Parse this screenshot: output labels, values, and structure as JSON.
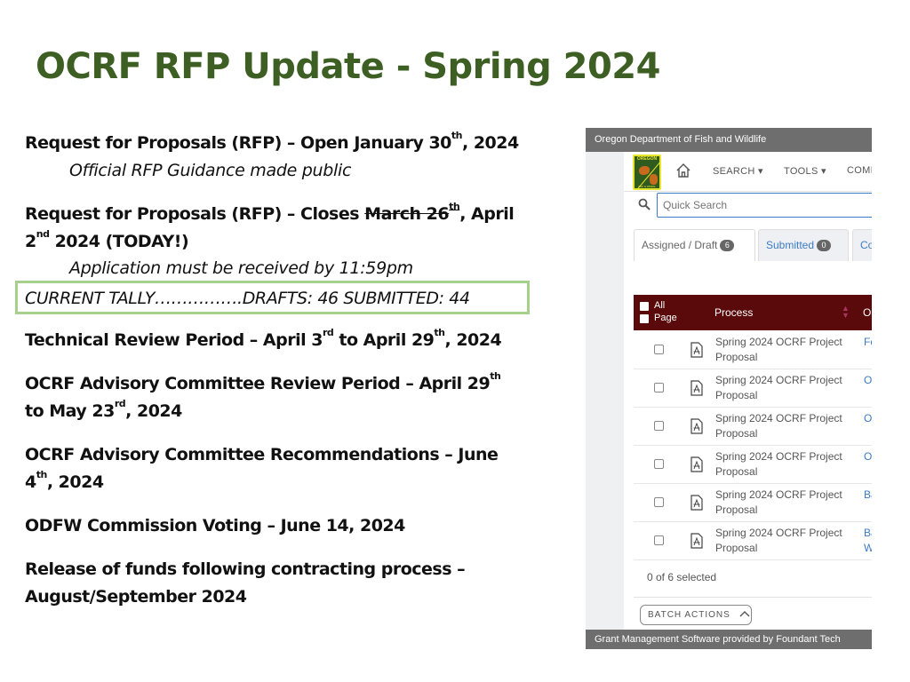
{
  "slide": {
    "title": "OCRF RFP Update - Spring 2024"
  },
  "timeline": {
    "open": {
      "text_a": "Request for Proposals (RFP) – Open January 30",
      "sup": "th",
      "text_b": ", 2024",
      "sub": "Official RFP Guidance made public"
    },
    "closes": {
      "text_a": "Request for Proposals (RFP) – Closes ",
      "struck": "March 26",
      "struck_sup": "th",
      "text_b": ", April",
      "line2_a": "2",
      "line2_sup": "nd",
      "line2_b": " 2024 (TODAY!)",
      "sub": "Application must be received by 11:59pm"
    },
    "tally": {
      "text": "CURRENT TALLY…………….DRAFTS: 46   SUBMITTED: 44",
      "drafts": 46,
      "submitted": 44
    },
    "technical": {
      "text_a": "Technical Review Period – April 3",
      "sup1": "rd",
      "text_b": " to April 29",
      "sup2": "th",
      "text_c": ", 2024"
    },
    "advisory_review": {
      "text_a": "OCRF Advisory Committee Review Period – April 29",
      "sup1": "th",
      "line2_a": "to May 23",
      "sup2": "rd",
      "line2_b": ", 2024"
    },
    "advisory_rec": {
      "text_a": "OCRF Advisory Committee Recommendations – June",
      "line2_a": "4",
      "sup": "th",
      "line2_b": ", 2024"
    },
    "commission": {
      "text": "ODFW Commission Voting – June 14, 2024"
    },
    "release": {
      "line1": "Release of funds following contracting process –",
      "line2": "August/September 2024"
    }
  },
  "screenshot": {
    "org_bar": "Oregon Department of Fish and Wildlife",
    "logo_top": "OREGON",
    "logo_bottom": "Fish & Wildlife",
    "nav": {
      "search": "SEARCH ▾",
      "tools": "TOOLS ▾",
      "more": "COMI"
    },
    "quick_search_placeholder": "Quick Search",
    "tabs": [
      {
        "label": "Assigned / Draft",
        "count": "6",
        "active": true
      },
      {
        "label": "Submitted",
        "count": "0",
        "active": false
      },
      {
        "label": "Co",
        "count": "",
        "active": false
      }
    ],
    "grid": {
      "select_all": "All",
      "select_page": "Page",
      "process_header": "Process",
      "next_header": "O",
      "rows": [
        {
          "line1": "Spring 2024 OCRF Project",
          "line2": "Proposal",
          "link1": "Fo",
          "link2": ""
        },
        {
          "line1": "Spring 2024 OCRF Project",
          "line2": "Proposal",
          "link1": "O",
          "link2": ""
        },
        {
          "line1": "Spring 2024 OCRF Project",
          "line2": "Proposal",
          "link1": "O",
          "link2": ""
        },
        {
          "line1": "Spring 2024 OCRF Project",
          "line2": "Proposal",
          "link1": "O",
          "link2": ""
        },
        {
          "line1": "Spring 2024 OCRF Project",
          "line2": "Proposal",
          "link1": "Ba",
          "link2": ""
        },
        {
          "line1": "Spring 2024 OCRF Project",
          "line2": "Proposal",
          "link1": "Ba",
          "link2": "W"
        }
      ]
    },
    "selected_count": "0 of 6 selected",
    "batch_actions": "BATCH ACTIONS",
    "footer": "Grant Management Software provided by Foundant Tech"
  },
  "colors": {
    "title_green": "#3d5f23",
    "tally_border": "#a8d08d",
    "grid_header": "#5a0a0a",
    "link_blue": "#3b7bc6",
    "bar_gray": "#6e6e6e"
  }
}
